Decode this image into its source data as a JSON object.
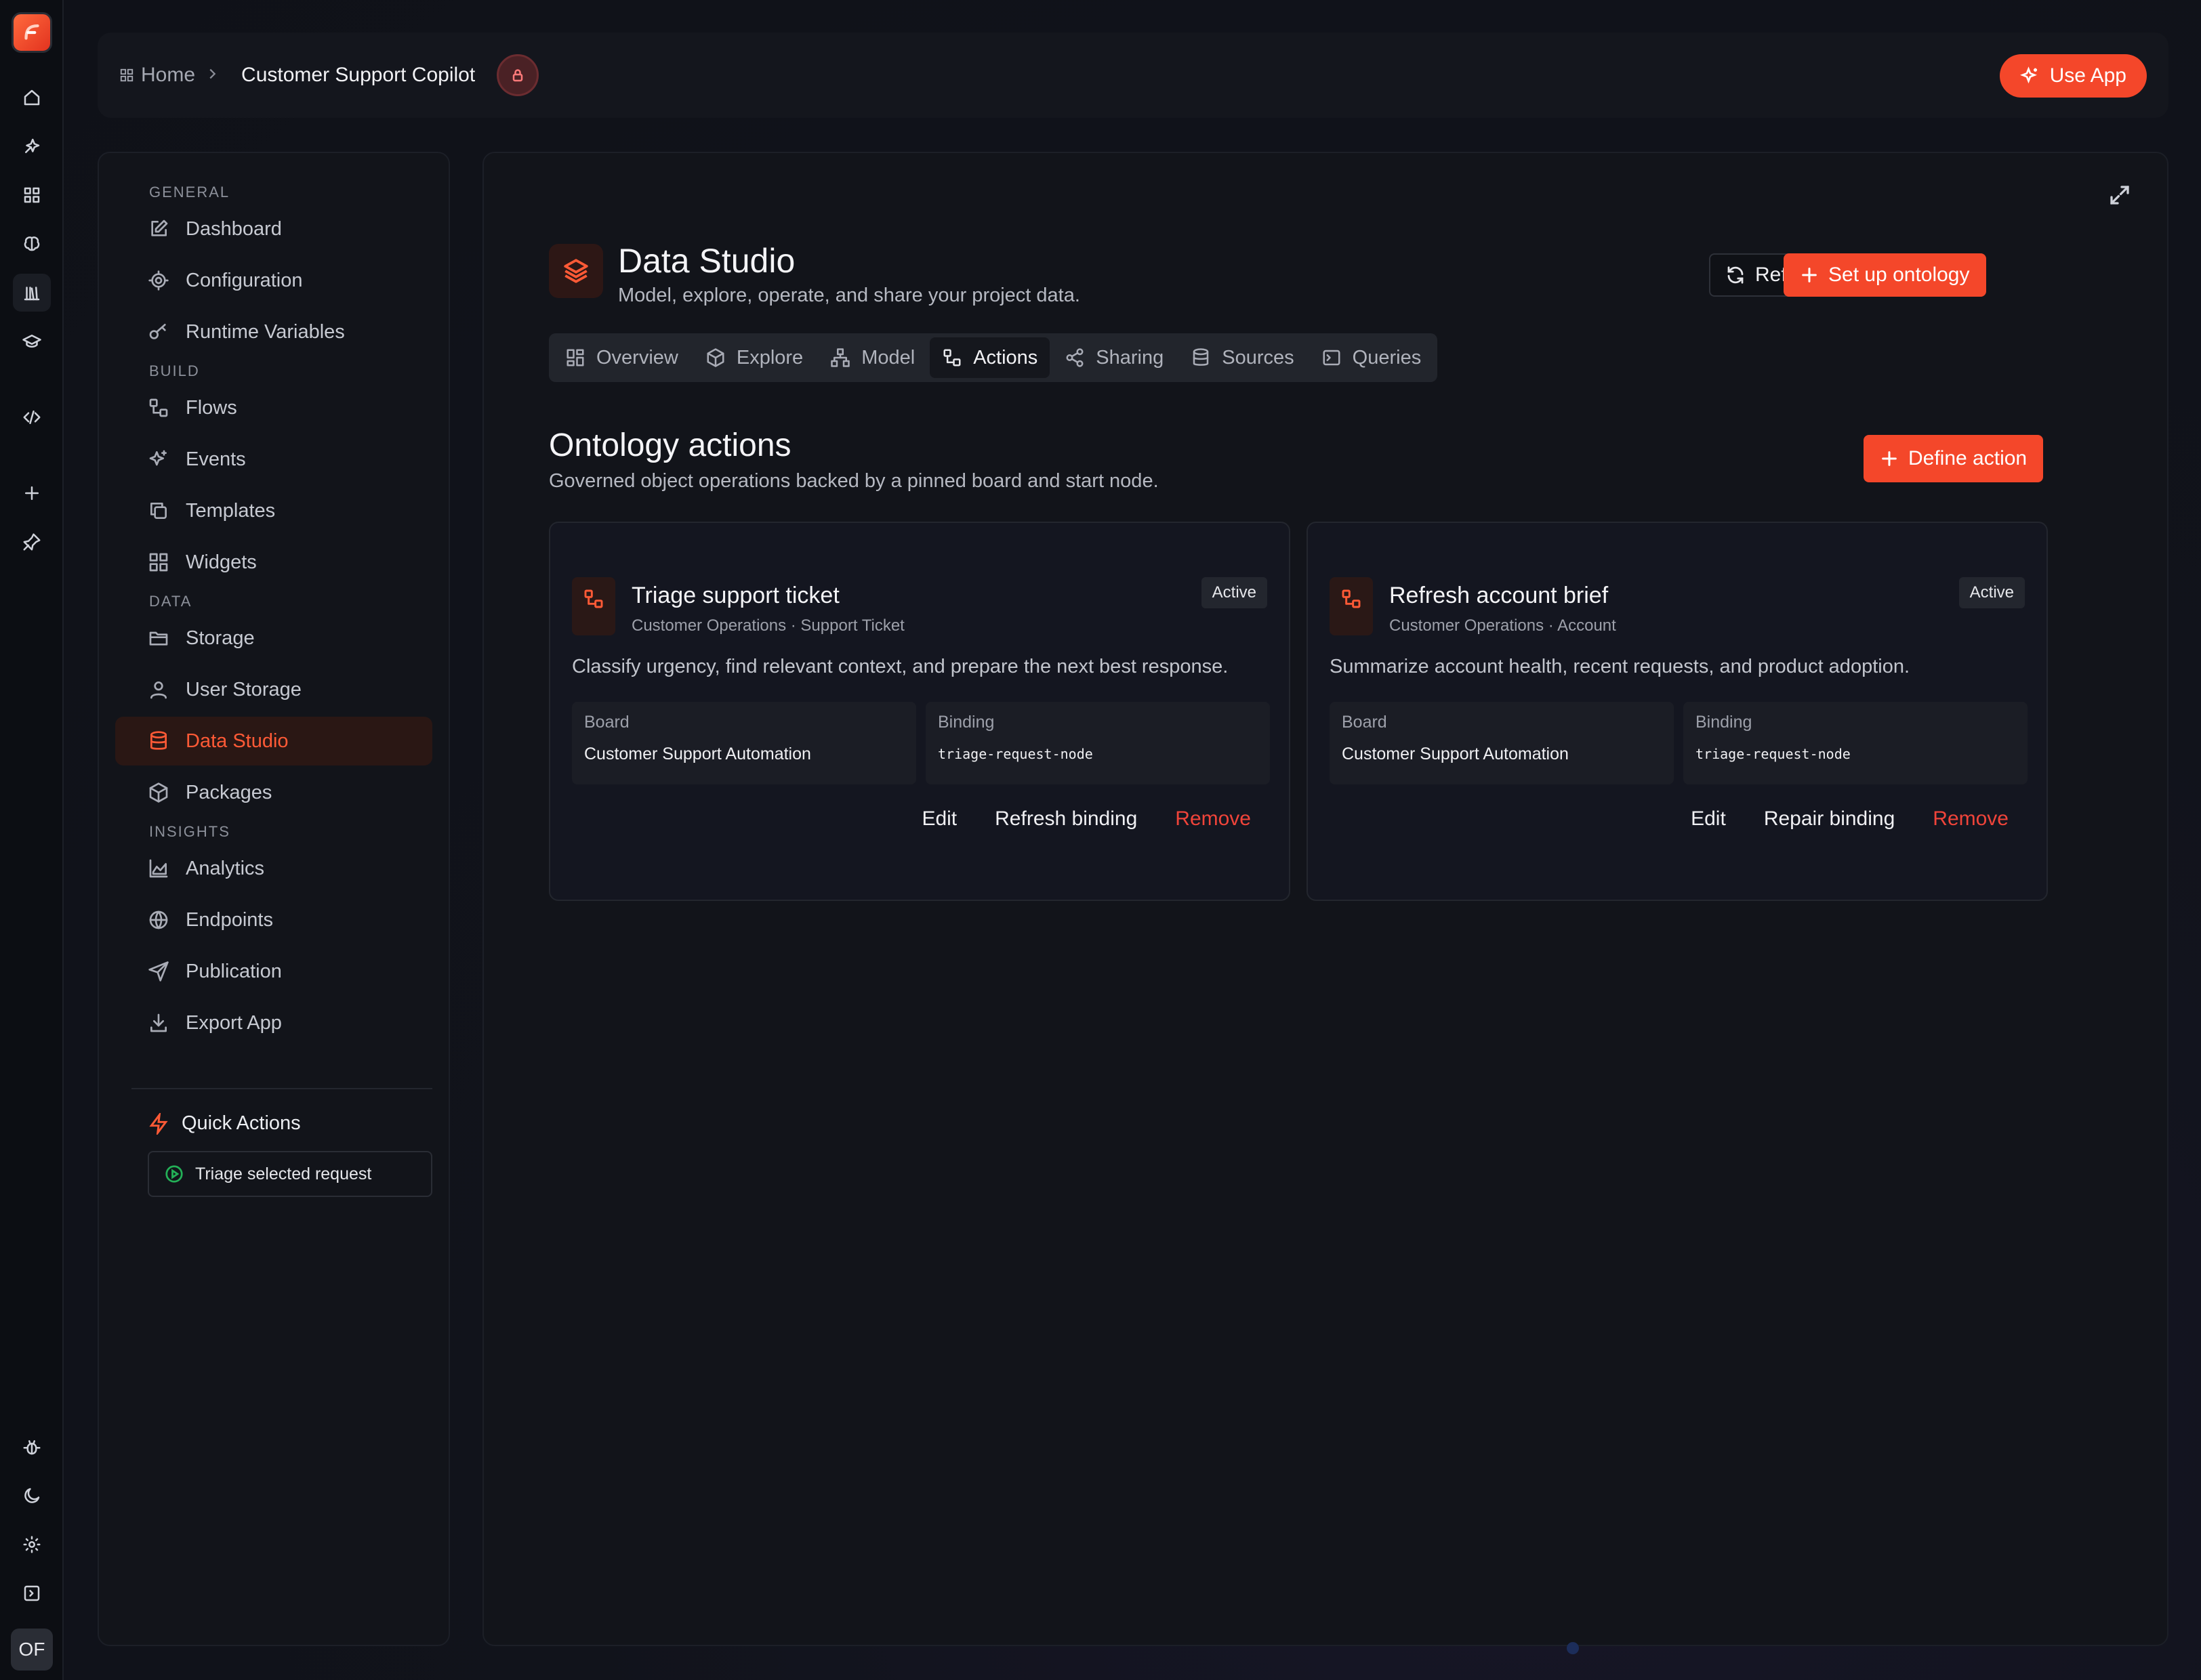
{
  "rail": {
    "logo": "flow-logo-icon",
    "items": [
      "home-icon",
      "sparkle-rocket-icon",
      "grid-icon",
      "brain-icon",
      "library-icon",
      "graduation-cap-icon",
      "code-icon",
      "plus-icon",
      "pin-icon"
    ],
    "bottom_items": [
      "bug-icon",
      "moon-icon",
      "gear-icon",
      "sidebar-toggle-icon"
    ],
    "avatar_initials": "OF"
  },
  "topbar": {
    "breadcrumb_home": "Home",
    "breadcrumb_current": "Customer Support Copilot",
    "lock_icon": "lock-icon",
    "use_app_label": "Use App"
  },
  "sidenav": {
    "sections": [
      {
        "title": "GENERAL",
        "items": [
          {
            "label": "Dashboard",
            "icon": "edit-icon"
          },
          {
            "label": "Configuration",
            "icon": "cog-icon"
          },
          {
            "label": "Runtime Variables",
            "icon": "key-icon"
          }
        ]
      },
      {
        "title": "BUILD",
        "items": [
          {
            "label": "Flows",
            "icon": "workflow-icon"
          },
          {
            "label": "Events",
            "icon": "sparkles-icon"
          },
          {
            "label": "Templates",
            "icon": "copy-icon"
          },
          {
            "label": "Widgets",
            "icon": "widgets-icon"
          }
        ]
      },
      {
        "title": "DATA",
        "items": [
          {
            "label": "Storage",
            "icon": "folder-icon"
          },
          {
            "label": "User Storage",
            "icon": "user-icon"
          },
          {
            "label": "Data Studio",
            "icon": "database-icon",
            "active": true
          },
          {
            "label": "Packages",
            "icon": "package-icon"
          }
        ]
      },
      {
        "title": "INSIGHTS",
        "items": [
          {
            "label": "Analytics",
            "icon": "area-chart-icon"
          },
          {
            "label": "Endpoints",
            "icon": "globe-icon"
          },
          {
            "label": "Publication",
            "icon": "send-icon"
          },
          {
            "label": "Export App",
            "icon": "download-icon"
          }
        ]
      }
    ],
    "quick_actions_title": "Quick Actions",
    "quick_action_label": "Triage selected request"
  },
  "studio": {
    "title": "Data Studio",
    "subtitle": "Model, explore, operate, and share your project data.",
    "refresh_label": "Refresh",
    "setup_label": "Set up ontology",
    "tabs": [
      {
        "label": "Overview",
        "icon": "layout-icon"
      },
      {
        "label": "Explore",
        "icon": "cube-icon"
      },
      {
        "label": "Model",
        "icon": "network-icon"
      },
      {
        "label": "Actions",
        "icon": "workflow-icon",
        "active": true
      },
      {
        "label": "Sharing",
        "icon": "share-icon"
      },
      {
        "label": "Sources",
        "icon": "database-icon"
      },
      {
        "label": "Queries",
        "icon": "terminal-icon"
      }
    ]
  },
  "actions_section": {
    "title": "Ontology actions",
    "subtitle": "Governed object operations backed by a pinned board and start node.",
    "define_label": "Define action"
  },
  "cards": [
    {
      "title": "Triage support ticket",
      "meta": "Customer Operations · Support Ticket",
      "status": "Active",
      "description": "Classify urgency, find relevant context, and prepare the next best response.",
      "board_label": "Board",
      "board_value": "Customer Support Automation",
      "binding_label": "Binding",
      "binding_value": "triage-request-node",
      "actions": {
        "edit": "Edit",
        "secondary": "Refresh binding",
        "remove": "Remove"
      }
    },
    {
      "title": "Refresh account brief",
      "meta": "Customer Operations · Account",
      "status": "Active",
      "description": "Summarize account health, recent requests, and product adoption.",
      "board_label": "Board",
      "board_value": "Customer Support Automation",
      "binding_label": "Binding",
      "binding_value": "triage-request-node",
      "actions": {
        "edit": "Edit",
        "secondary": "Repair binding",
        "remove": "Remove"
      }
    }
  ],
  "colors": {
    "accent": "#f4472a",
    "danger": "#f0443a",
    "success": "#23b057",
    "background": "#0f1118"
  }
}
